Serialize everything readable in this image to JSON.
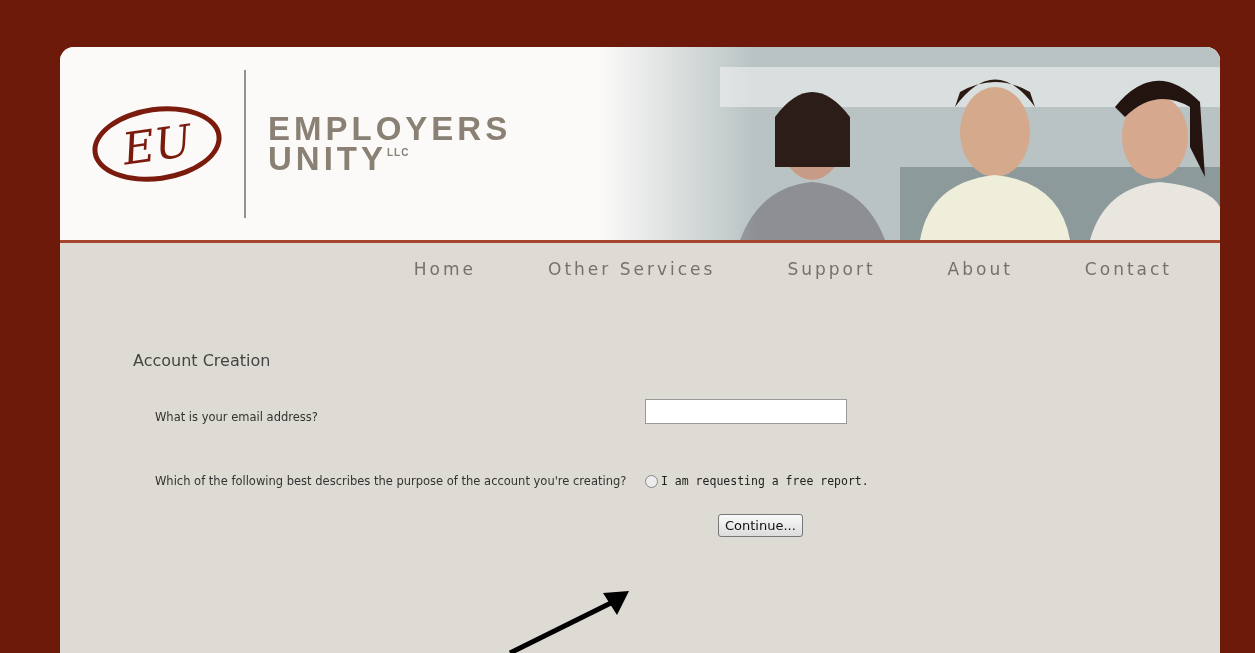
{
  "logo": {
    "monogram": "EU",
    "name_line_1": "EMPLOYERS",
    "name_line_2": "UNITY",
    "suffix": "LLC"
  },
  "nav": [
    {
      "label": "Home"
    },
    {
      "label": "Other Services"
    },
    {
      "label": "Support"
    },
    {
      "label": "About"
    },
    {
      "label": "Contact"
    }
  ],
  "form": {
    "title": "Account Creation",
    "email_question": "What is your email address?",
    "purpose_question": "Which of the following best describes the purpose of the account you're creating?",
    "options": [
      {
        "label": "I am requesting a free report.",
        "selected": false
      }
    ],
    "continue_button": "Continue..."
  }
}
